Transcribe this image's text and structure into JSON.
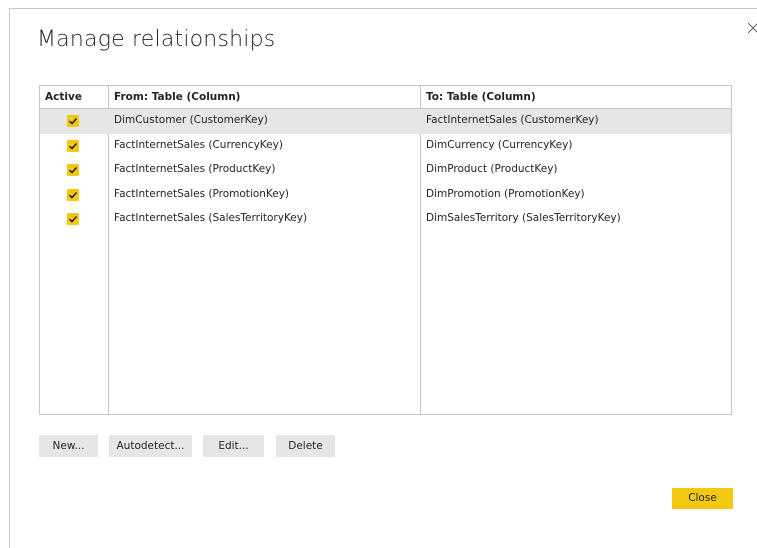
{
  "dialog": {
    "title": "Manage relationships",
    "close_icon": "close-icon"
  },
  "table": {
    "headers": {
      "active": "Active",
      "from": "From: Table (Column)",
      "to": "To: Table (Column)"
    },
    "rows": [
      {
        "active": true,
        "from": "DimCustomer (CustomerKey)",
        "to": "FactInternetSales (CustomerKey)",
        "selected": true
      },
      {
        "active": true,
        "from": "FactInternetSales (CurrencyKey)",
        "to": "DimCurrency (CurrencyKey)",
        "selected": false
      },
      {
        "active": true,
        "from": "FactInternetSales (ProductKey)",
        "to": "DimProduct (ProductKey)",
        "selected": false
      },
      {
        "active": true,
        "from": "FactInternetSales (PromotionKey)",
        "to": "DimPromotion (PromotionKey)",
        "selected": false
      },
      {
        "active": true,
        "from": "FactInternetSales (SalesTerritoryKey)",
        "to": "DimSalesTerritory (SalesTerritoryKey)",
        "selected": false
      }
    ]
  },
  "buttons": {
    "new_label": "New...",
    "autodetect_label": "Autodetect...",
    "edit_label": "Edit...",
    "delete_label": "Delete",
    "close_label": "Close"
  },
  "colors": {
    "accent": "#f2c811",
    "button_bg": "#e6e6e6",
    "selected_row": "#e6e6e6",
    "border": "#c8c6c4"
  }
}
